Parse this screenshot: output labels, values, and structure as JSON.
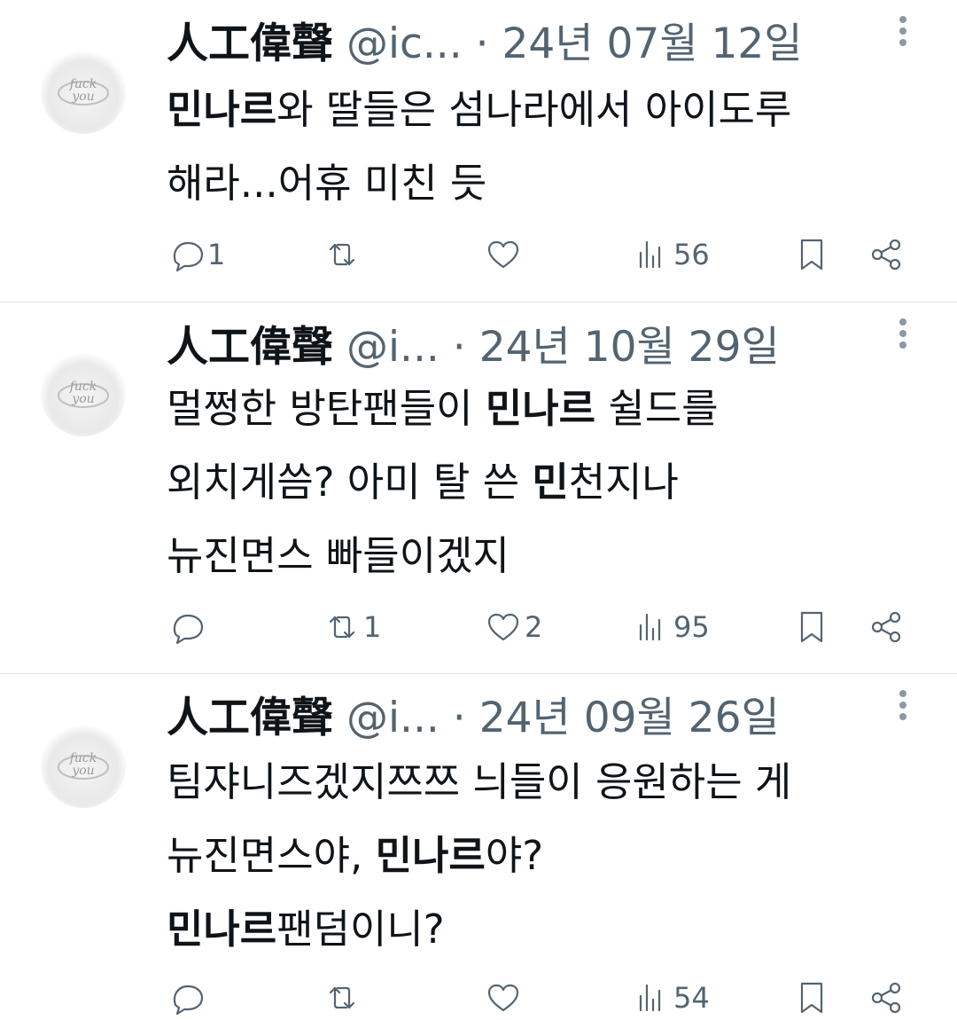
{
  "tweets": [
    {
      "name": "人工偉聲",
      "handle": "@ic...",
      "separator": "·",
      "date": "24년 07월 12일",
      "lines": [
        [
          {
            "text": "민나르",
            "bold": true
          },
          {
            "text": "와 딸들은 섬나라에서 아이도루"
          }
        ],
        [
          {
            "text": "해라...어휴 미친 듯"
          }
        ]
      ],
      "replies": "1",
      "retweets": "",
      "likes": "",
      "views": "56"
    },
    {
      "name": "人工偉聲",
      "handle": "@i...",
      "separator": "·",
      "date": "24년 10월 29일",
      "lines": [
        [
          {
            "text": "멀쩡한 방탄팬들이 "
          },
          {
            "text": "민나르",
            "bold": true
          },
          {
            "text": " 쉴드를"
          }
        ],
        [
          {
            "text": "외치게씀? 아미 탈 쓴 "
          },
          {
            "text": "민",
            "bold": true
          },
          {
            "text": "천지나"
          }
        ],
        [
          {
            "text": "뉴진면스 빠들이겠지"
          }
        ]
      ],
      "replies": "",
      "retweets": "1",
      "likes": "2",
      "views": "95"
    },
    {
      "name": "人工偉聲",
      "handle": "@i...",
      "separator": "·",
      "date": "24년 09월 26일",
      "lines": [
        [
          {
            "text": "팀쟈니즈겠지쯔쯔 늬들이 응원하는 게"
          }
        ],
        [
          {
            "text": "뉴진면스야, "
          },
          {
            "text": "민나르",
            "bold": true
          },
          {
            "text": "야?"
          }
        ],
        [
          {
            "text": "민나르",
            "bold": true
          },
          {
            "text": "팬덤이니?"
          }
        ]
      ],
      "replies": "",
      "retweets": "",
      "likes": "",
      "views": "54"
    }
  ],
  "colors": {
    "text": "#0f1419",
    "secondary": "#536471",
    "divider": "#dfe3e7"
  },
  "icons": [
    "reply-icon",
    "retweet-icon",
    "like-icon",
    "views-icon",
    "bookmark-icon",
    "share-icon",
    "more-icon",
    "avatar-ring-image"
  ]
}
